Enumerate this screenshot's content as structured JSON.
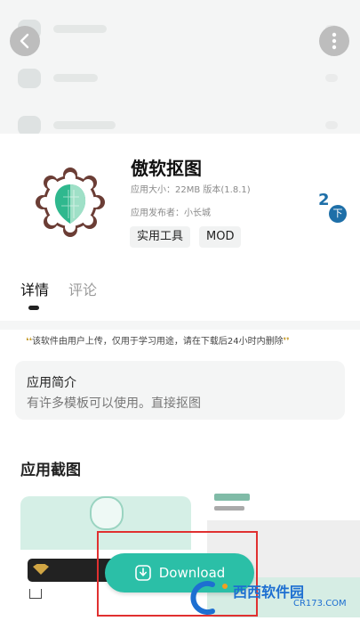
{
  "app": {
    "name": "傲软抠图",
    "size_line": "应用大小：22MB  版本(1.8.1)",
    "publisher_line": "应用发布者：小长城",
    "tags": [
      "实用工具",
      "MOD"
    ],
    "download_count": "2",
    "download_badge": "下"
  },
  "tabs": [
    {
      "label": "详情",
      "active": true
    },
    {
      "label": "评论",
      "active": false
    }
  ],
  "notice": {
    "open_quote": "❛❛",
    "text": "该软件由用户上传，仅用于学习用途，请在下载后24小时内删除",
    "close_quote": "❜❜"
  },
  "intro": {
    "title": "应用简介",
    "text": "有许多模板可以使用。直接抠图"
  },
  "screenshots": {
    "title": "应用截图"
  },
  "download_button": {
    "label": "Download"
  },
  "watermark": {
    "text": "西西软件园",
    "url": "CR173.COM"
  },
  "colors": {
    "accent": "#2bbfa7",
    "badge": "#1e6fa8",
    "highlight_border": "#e03030"
  },
  "icons": [
    "back-arrow-icon",
    "more-vertical-icon",
    "app-logo-icon",
    "download-icon",
    "quote-icon"
  ]
}
